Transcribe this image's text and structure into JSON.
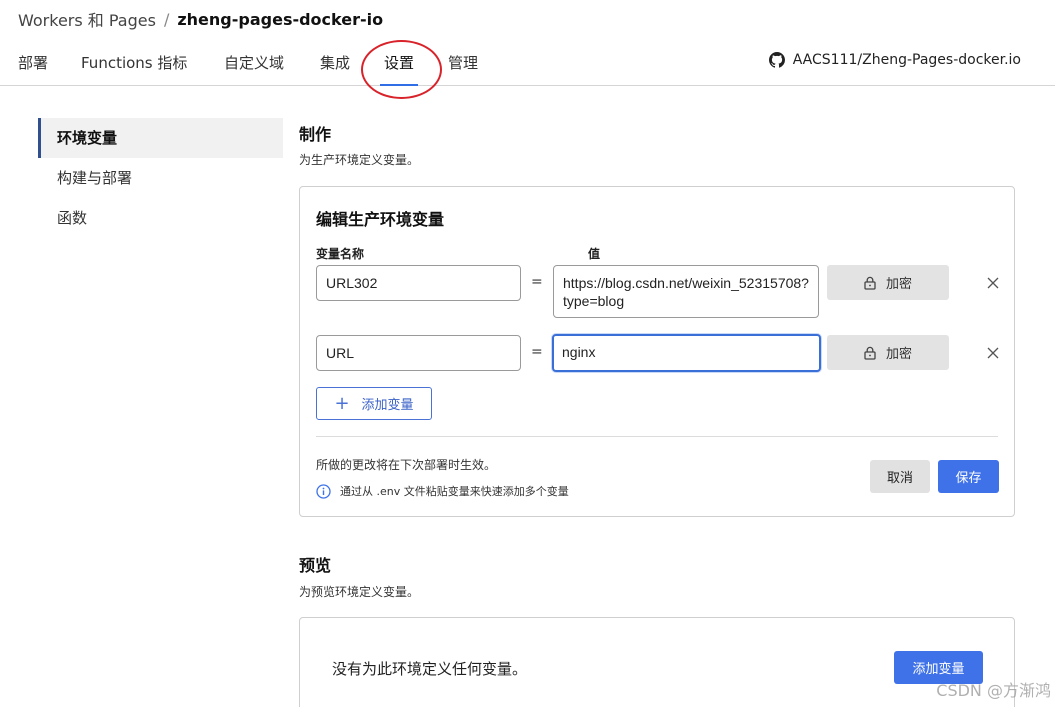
{
  "breadcrumb": {
    "root": "Workers 和 Pages",
    "separator": "/",
    "current": "zheng-pages-docker-io"
  },
  "tabs": [
    {
      "label": "部署"
    },
    {
      "label": "Functions 指标"
    },
    {
      "label": "自定义域"
    },
    {
      "label": "集成"
    },
    {
      "label": "设置",
      "active": true
    },
    {
      "label": "管理"
    }
  ],
  "repo": {
    "label": "AACS111/Zheng-Pages-docker.io",
    "icon": "github-icon"
  },
  "side_nav": {
    "items": [
      {
        "label": "环境变量",
        "active": true
      },
      {
        "label": "构建与部署"
      },
      {
        "label": "函数"
      }
    ]
  },
  "production": {
    "title": "制作",
    "description": "为生产环境定义变量。",
    "card_title": "编辑生产环境变量",
    "col_name": "变量名称",
    "col_value": "值",
    "rows": [
      {
        "name": "URL302",
        "value": "https://blog.csdn.net/weixin_52315708?type=blog",
        "encrypt_label": "加密"
      },
      {
        "name": "URL",
        "value": "nginx",
        "encrypt_label": "加密"
      }
    ],
    "equals": "=",
    "add_variable_label": "添加变量",
    "note": "所做的更改将在下次部署时生效。",
    "hint": "通过从 .env 文件粘贴变量来快速添加多个变量",
    "cancel_label": "取消",
    "save_label": "保存"
  },
  "preview": {
    "title": "预览",
    "description": "为预览环境定义变量。",
    "empty_text": "没有为此环境定义任何变量。",
    "add_variable_label": "添加变量"
  },
  "watermark": "CSDN @方渐鸿",
  "colors": {
    "accent": "#3f72e8",
    "annotation": "#d8232a"
  }
}
